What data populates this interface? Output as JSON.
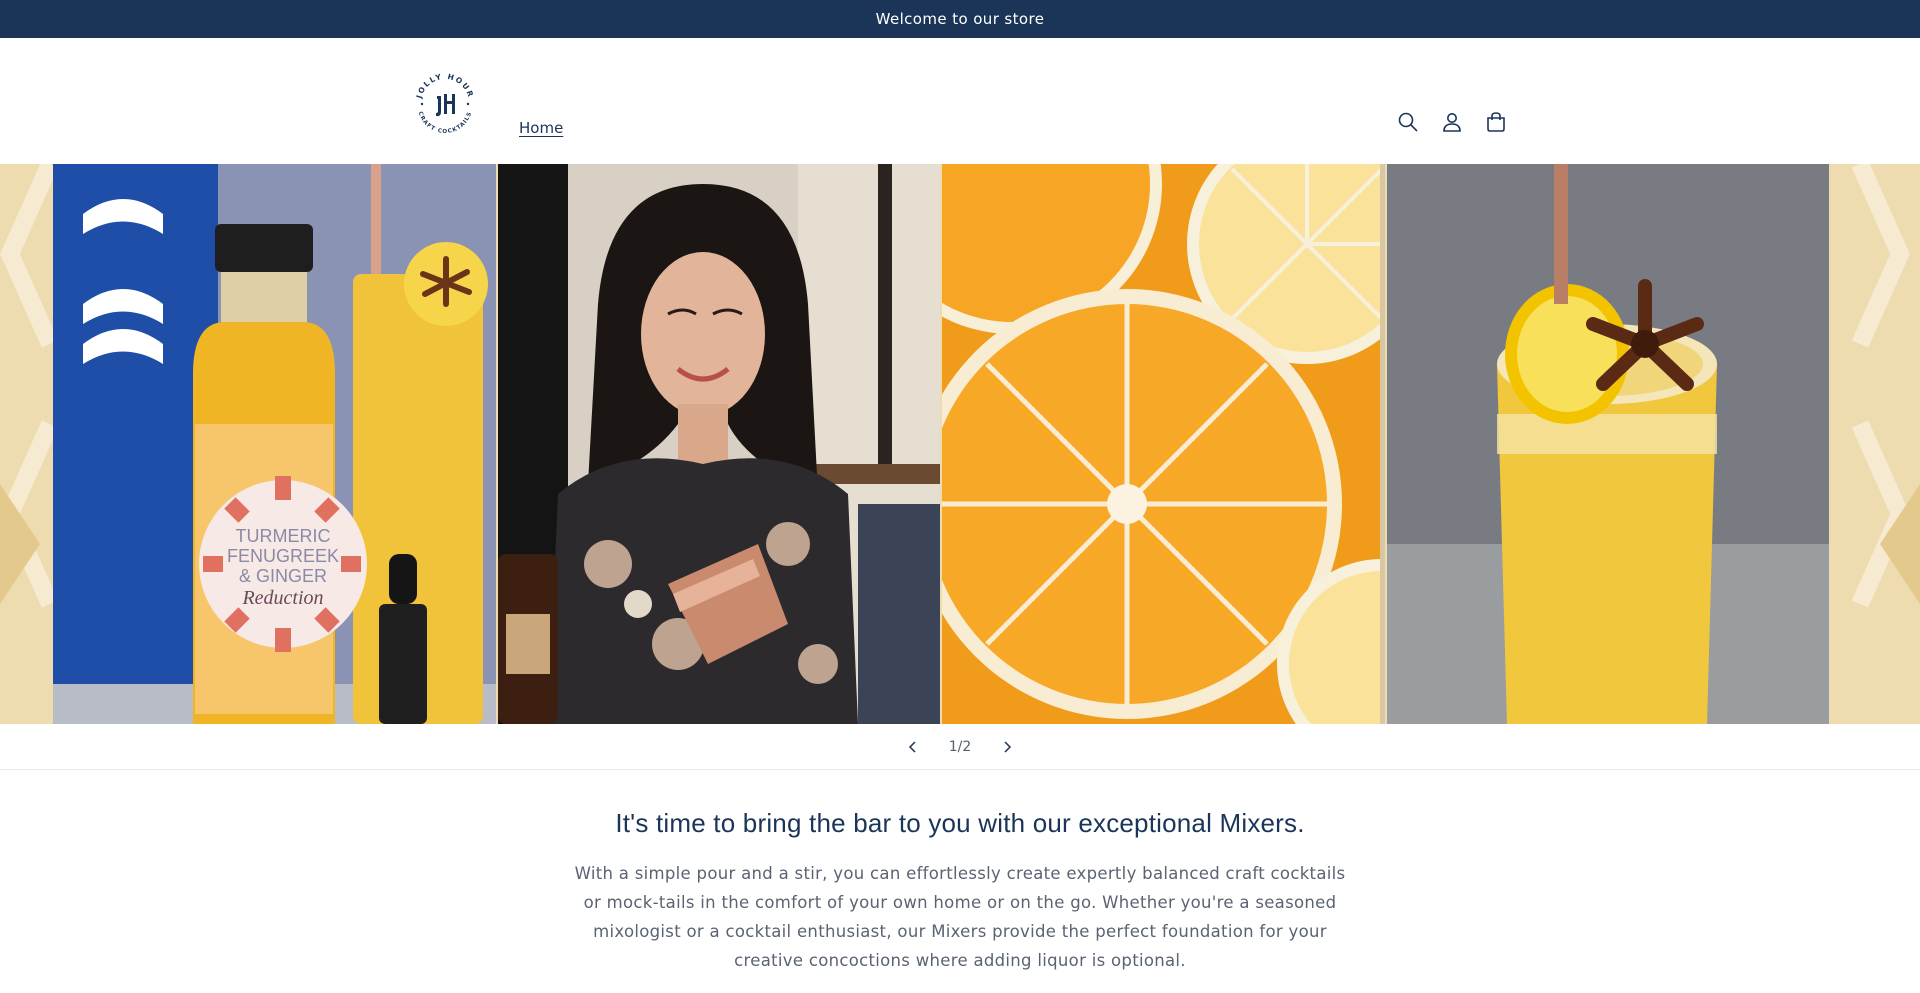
{
  "announcement": {
    "text": "Welcome to our store"
  },
  "header": {
    "logo": {
      "top_text": "JOLLY HOUR",
      "bottom_text": "CRAFT COCKTAILS",
      "monogram": "JH"
    },
    "nav": [
      {
        "label": "Home"
      }
    ],
    "icons": [
      "search-icon",
      "account-icon",
      "cart-icon"
    ]
  },
  "hero": {
    "panels": [
      {
        "name": "mixer-bottle",
        "label_lines": [
          "TURMERIC",
          "FENUGREEK",
          "& GINGER"
        ],
        "label_script": "Reduction"
      },
      {
        "name": "bartender"
      },
      {
        "name": "citrus-slices"
      },
      {
        "name": "cocktail-glass"
      }
    ]
  },
  "slider": {
    "counter": "1/2"
  },
  "intro": {
    "heading": "It's time to bring the bar to you with our exceptional Mixers.",
    "body": "With a simple pour and a stir, you can effortlessly create expertly balanced craft cocktails or mock-tails in the comfort of your own home or on the go. Whether you're a seasoned mixologist or a cocktail enthusiast, our Mixers provide the perfect foundation for your creative concoctions where adding liquor is optional."
  },
  "colors": {
    "brand_navy": "#1b3558",
    "hero_background": "#eedcb0",
    "body_text": "#5a6372"
  }
}
